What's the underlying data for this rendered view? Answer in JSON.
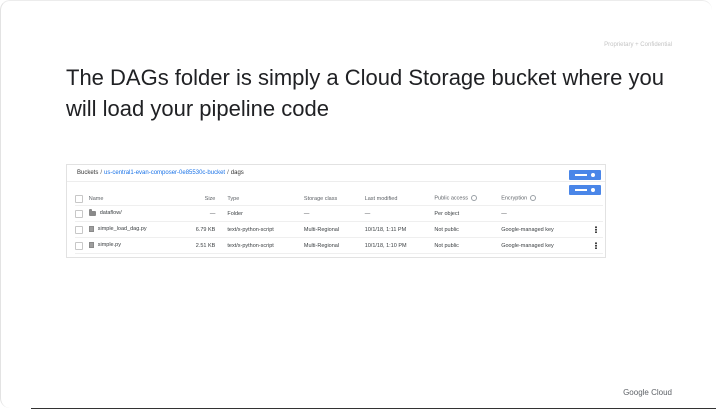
{
  "slide": {
    "confidential_label": "Proprietary + Confidential",
    "headline": "The DAGs folder is simply a Cloud Storage bucket where you will load your pipeline code",
    "brand": "Google Cloud"
  },
  "bucket_browser": {
    "breadcrumb": {
      "root": "Buckets",
      "separator": "/",
      "bucket": "us-central1-evan-composer-0e85530c-bucket",
      "folder": "dags"
    },
    "columns": [
      "Name",
      "Size",
      "Type",
      "Storage class",
      "Last modified",
      "Public access",
      "Encryption"
    ],
    "rows": [
      {
        "icon": "folder-icon",
        "name": "dataflow/",
        "size": "—",
        "type": "Folder",
        "storage_class": "—",
        "last_modified": "—",
        "public_access": "Per object",
        "encryption": "—",
        "has_menu": false
      },
      {
        "icon": "file-icon",
        "name": "simple_load_dag.py",
        "size": "6.79 KB",
        "type": "text/x-python-script",
        "storage_class": "Multi-Regional",
        "last_modified": "10/1/18, 1:11 PM",
        "public_access": "Not public",
        "encryption": "Google-managed key",
        "has_menu": true
      },
      {
        "icon": "file-icon",
        "name": "simple.py",
        "size": "2.51 KB",
        "type": "text/x-python-script",
        "storage_class": "Multi-Regional",
        "last_modified": "10/1/18, 1:10 PM",
        "public_access": "Not public",
        "encryption": "Google-managed key",
        "has_menu": true
      }
    ]
  },
  "colors": {
    "accent": "#4a86e8",
    "link": "#1a73e8",
    "text": "#202124"
  }
}
